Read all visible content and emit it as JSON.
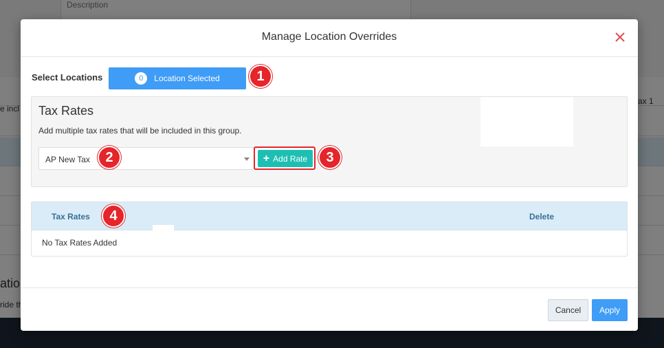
{
  "background": {
    "description_label": "Description",
    "left_row_text": "e incl",
    "right_row_text": "ax 1",
    "section_heading": "ation",
    "section_sub": "ride th"
  },
  "modal": {
    "title": "Manage Location Overrides",
    "close_icon": "close-x-icon",
    "select_locations_label": "Select Locations",
    "location_count": "0",
    "location_button_label": "Location Selected",
    "tax_rates_title": "Tax Rates",
    "tax_rates_description": "Add multiple tax rates that will be included in this group.",
    "tax_select_value": "AP New Tax",
    "add_rate_icon": "+",
    "add_rate_label": "Add Rate",
    "table": {
      "columns": [
        "Tax Rates",
        "Delete"
      ],
      "empty_text": "No Tax Rates Added"
    },
    "cancel_label": "Cancel",
    "apply_label": "Apply"
  },
  "markers": [
    "1",
    "2",
    "3",
    "4"
  ],
  "colors": {
    "primary_blue": "#3f9cf7",
    "teal": "#1ebfb3",
    "marker_red": "#e5252a",
    "header_blue": "#d9ecf7"
  }
}
